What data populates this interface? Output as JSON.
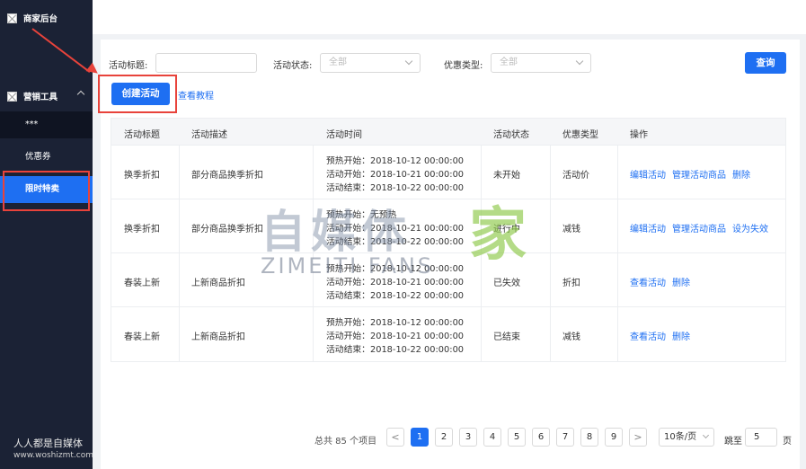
{
  "sidebar": {
    "brand": "商家后台",
    "group": "营销工具",
    "items": [
      {
        "label": "***"
      },
      {
        "label": "优惠券"
      },
      {
        "label": "限时特卖"
      }
    ],
    "footer_text": "人人都是自媒体",
    "footer_url": "www.woshizmt.com"
  },
  "filters": {
    "title_label": "活动标题:",
    "title_value": "",
    "status_label": "活动状态:",
    "status_selected": "全部",
    "type_label": "优惠类型:",
    "type_selected": "全部",
    "query_button": "查询"
  },
  "actions": {
    "create_button": "创建活动",
    "tutorial_link": "查看教程"
  },
  "table": {
    "headers": [
      "活动标题",
      "活动描述",
      "活动时间",
      "活动状态",
      "优惠类型",
      "操作"
    ],
    "rows": [
      {
        "title": "换季折扣",
        "desc": "部分商品换季折扣",
        "time": [
          "预热开始：2018-10-12 00:00:00",
          "活动开始：2018-10-21 00:00:00",
          "活动结束：2018-10-22 00:00:00"
        ],
        "status": "未开始",
        "type": "活动价",
        "ops": [
          "编辑活动",
          "管理活动商品",
          "删除"
        ]
      },
      {
        "title": "换季折扣",
        "desc": "部分商品换季折扣",
        "time": [
          "预热开始：无预热",
          "活动开始：2018-10-21 00:00:00",
          "活动结束：2018-10-22 00:00:00"
        ],
        "status": "进行中",
        "type": "减钱",
        "ops": [
          "编辑活动",
          "管理活动商品",
          "设为失效"
        ]
      },
      {
        "title": "春装上新",
        "desc": "上新商品折扣",
        "time": [
          "预热开始：2018-10-12 00:00:00",
          "活动开始：2018-10-21 00:00:00",
          "活动结束：2018-10-22 00:00:00"
        ],
        "status": "已失效",
        "type": "折扣",
        "ops": [
          "查看活动",
          "删除"
        ]
      },
      {
        "title": "春装上新",
        "desc": "上新商品折扣",
        "time": [
          "预热开始：2018-10-12 00:00:00",
          "活动开始：2018-10-21 00:00:00",
          "活动结束：2018-10-22 00:00:00"
        ],
        "status": "已结束",
        "type": "减钱",
        "ops": [
          "查看活动",
          "删除"
        ]
      }
    ]
  },
  "pagination": {
    "total_text": "总共 85 个项目",
    "prev": "<",
    "next": ">",
    "pages": [
      "1",
      "2",
      "3",
      "4",
      "5",
      "6",
      "7",
      "8",
      "9"
    ],
    "current": "1",
    "page_size": "10条/页",
    "jump_prefix": "跳至",
    "jump_value": "5",
    "jump_suffix": "页"
  },
  "watermark": {
    "cn_left": "自媒体",
    "cn_right": "家",
    "en": "ZIMEITI FANS"
  },
  "colors": {
    "primary": "#1e6ff2",
    "sidebar_bg": "#1b2235",
    "annotation": "#e8433b"
  }
}
